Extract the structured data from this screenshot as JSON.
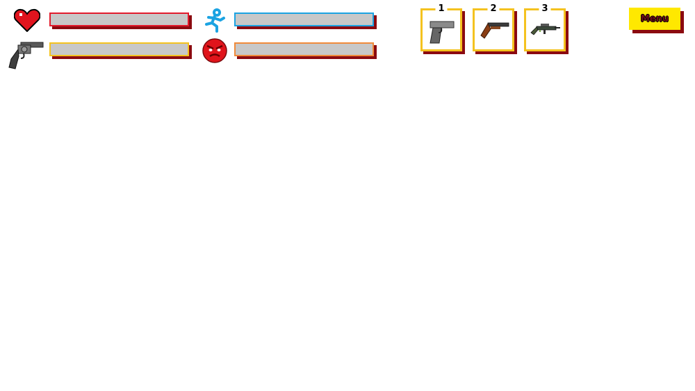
{
  "hud": {
    "health": {
      "icon": "heart-icon",
      "level": 0.0,
      "color": "#e21b2c"
    },
    "stamina": {
      "icon": "running-figure-icon",
      "level": 0.0,
      "color": "#1ba3e2"
    },
    "ammo": {
      "icon": "revolver-icon",
      "level": 0.0,
      "color": "#f4c21f"
    },
    "rage": {
      "icon": "angry-face-icon",
      "level": 0.0,
      "color": "#f08a3a"
    }
  },
  "weapons": [
    {
      "number": "1",
      "icon": "pistol-icon"
    },
    {
      "number": "2",
      "icon": "shotgun-icon"
    },
    {
      "number": "3",
      "icon": "rifle-icon"
    }
  ],
  "menu": {
    "label": "Menu",
    "color": "#ffe800"
  },
  "colors": {
    "shadow": "#8b0a10",
    "bar_fill": "#c8c8c8"
  }
}
